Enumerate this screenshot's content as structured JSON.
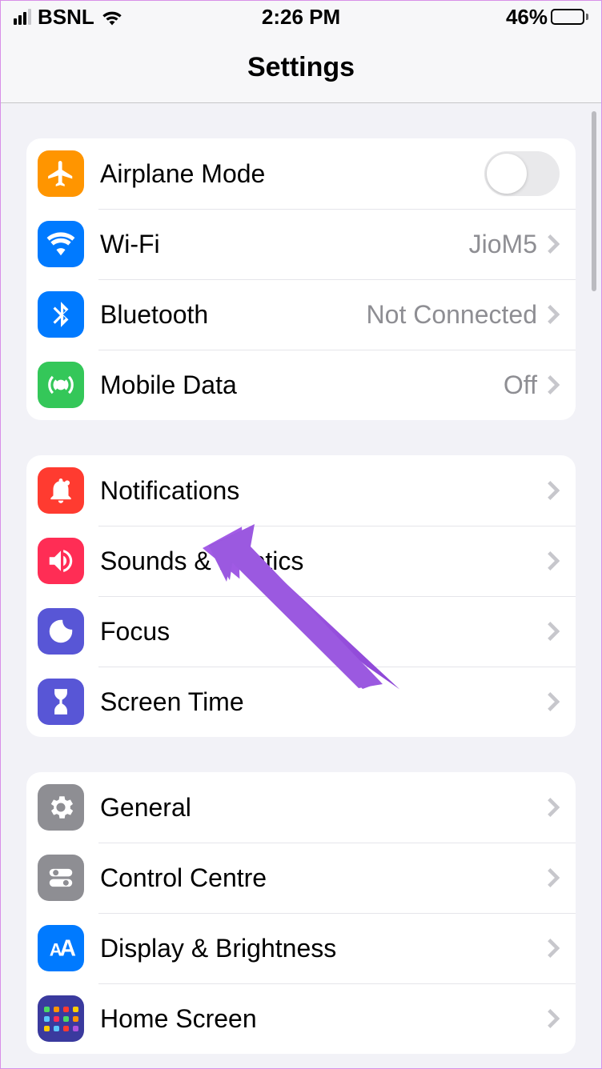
{
  "status": {
    "carrier": "BSNL",
    "time": "2:26 PM",
    "battery": "46%"
  },
  "header": {
    "title": "Settings"
  },
  "sections": [
    {
      "rows": [
        {
          "id": "airplane",
          "label": "Airplane Mode",
          "color": "#ff9500",
          "type": "toggle"
        },
        {
          "id": "wifi",
          "label": "Wi-Fi",
          "value": "JioM5",
          "color": "#007aff",
          "type": "link"
        },
        {
          "id": "bluetooth",
          "label": "Bluetooth",
          "value": "Not Connected",
          "color": "#007aff",
          "type": "link"
        },
        {
          "id": "mobile",
          "label": "Mobile Data",
          "value": "Off",
          "color": "#34c759",
          "type": "link"
        }
      ]
    },
    {
      "rows": [
        {
          "id": "notifications",
          "label": "Notifications",
          "color": "#ff3b30",
          "type": "link"
        },
        {
          "id": "sounds",
          "label": "Sounds & Haptics",
          "color": "#ff2d55",
          "type": "link"
        },
        {
          "id": "focus",
          "label": "Focus",
          "color": "#5856d6",
          "type": "link"
        },
        {
          "id": "screentime",
          "label": "Screen Time",
          "color": "#5856d6",
          "type": "link"
        }
      ]
    },
    {
      "rows": [
        {
          "id": "general",
          "label": "General",
          "color": "#8e8e93",
          "type": "link"
        },
        {
          "id": "controlcentre",
          "label": "Control Centre",
          "color": "#8e8e93",
          "type": "link"
        },
        {
          "id": "display",
          "label": "Display & Brightness",
          "color": "#007aff",
          "type": "link"
        },
        {
          "id": "homescreen",
          "label": "Home Screen",
          "color": "#3a3a9e",
          "type": "link"
        }
      ]
    }
  ],
  "annotation": {
    "target": "focus",
    "color": "#9b59e0"
  }
}
